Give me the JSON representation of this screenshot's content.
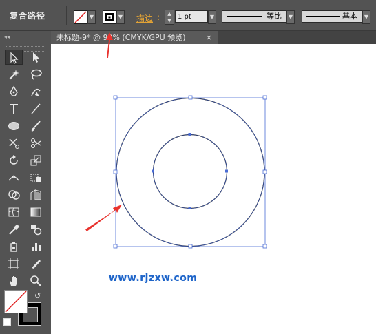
{
  "control_bar": {
    "title": "复合路径",
    "stroke_label": "描边",
    "stroke_weight": "1 pt",
    "profile_label": "等比",
    "brush_label": "基本"
  },
  "document_tab": {
    "title": "未标题-9* @ 92% (CMYK/GPU 预览)",
    "close_glyph": "×"
  },
  "toolbox": {
    "tools": [
      "selection-tool",
      "direct-selection-tool",
      "magic-wand-tool",
      "lasso-tool",
      "pen-tool",
      "curvature-tool",
      "type-tool",
      "line-segment-tool",
      "ellipse-tool",
      "paintbrush-tool",
      "scissors-tool",
      "eraser-tool",
      "rotate-tool",
      "scale-tool",
      "width-tool",
      "free-transform-tool",
      "shape-builder-tool",
      "perspective-grid-tool",
      "mesh-tool",
      "gradient-tool",
      "eyedropper-tool",
      "blend-tool",
      "symbol-sprayer-tool",
      "column-graph-tool",
      "artboard-tool",
      "slice-tool",
      "hand-tool",
      "zoom-tool"
    ]
  },
  "colors": {
    "fill": "none",
    "stroke": "#000000",
    "selection": "#4a6cd4",
    "arrow": "#e8332e"
  },
  "watermark": "www.rjzxw.com"
}
